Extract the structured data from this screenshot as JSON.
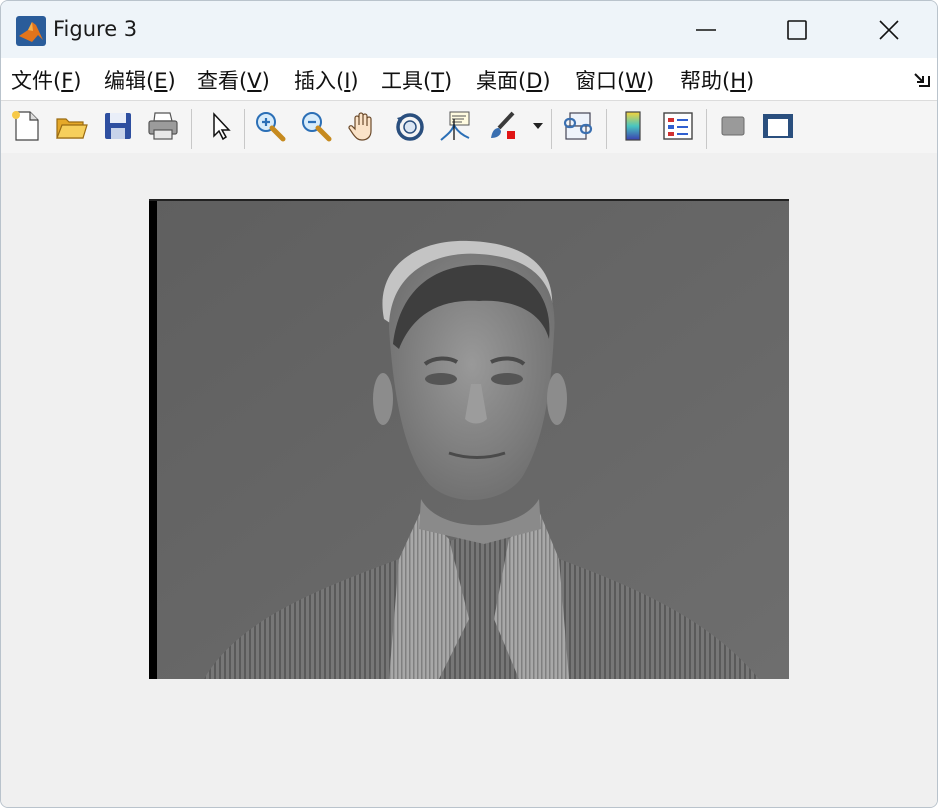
{
  "window": {
    "title": "Figure 3"
  },
  "menu": {
    "items": [
      {
        "text": "文件(",
        "key": "F",
        "close": ")"
      },
      {
        "text": "编辑(",
        "key": "E",
        "close": ")"
      },
      {
        "text": "查看(",
        "key": "V",
        "close": ")"
      },
      {
        "text": "插入(",
        "key": "I",
        "close": ")"
      },
      {
        "text": "工具(",
        "key": "T",
        "close": ")"
      },
      {
        "text": "桌面(",
        "key": "D",
        "close": ")"
      },
      {
        "text": "窗口(",
        "key": "W",
        "close": ")"
      },
      {
        "text": "帮助(",
        "key": "H",
        "close": ")"
      }
    ]
  },
  "toolbar": {
    "icons": [
      "new-figure-icon",
      "open-file-icon",
      "save-icon",
      "print-icon",
      "edit-plot-arrow-icon",
      "zoom-in-icon",
      "zoom-out-icon",
      "pan-hand-icon",
      "rotate-3d-icon",
      "data-cursor-icon",
      "brush-icon",
      "brush-dropdown-icon",
      "link-plot-icon",
      "colorbar-icon",
      "legend-icon",
      "hide-plot-tools-icon",
      "show-plot-tools-icon"
    ]
  },
  "colors": {
    "titlebar": "#eef4f9",
    "canvas": "#f0f0f0",
    "photo_background": "#646464"
  }
}
